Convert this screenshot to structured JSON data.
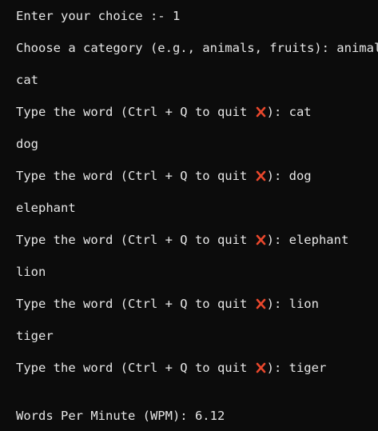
{
  "terminal": {
    "menu_prompt": "Enter your choice :- ",
    "menu_choice": "1",
    "category_prompt": "Choose a category (e.g., animals, fruits): ",
    "category_value": "animals",
    "type_prompt_prefix": "Type the word (Ctrl + Q to quit ",
    "type_prompt_suffix": "): ",
    "rounds": [
      {
        "shown": "cat",
        "typed": "cat"
      },
      {
        "shown": "dog",
        "typed": "dog"
      },
      {
        "shown": "elephant",
        "typed": "elephant"
      },
      {
        "shown": "lion",
        "typed": "lion"
      },
      {
        "shown": "tiger",
        "typed": "tiger"
      }
    ],
    "wpm_label": "Words Per Minute (WPM): ",
    "wpm_value": "6.12",
    "quit_icon": "cross-mark-icon",
    "quit_icon_color": "#e8472c",
    "background_color": "#0c0c0c",
    "text_color": "#e6e6e6"
  }
}
